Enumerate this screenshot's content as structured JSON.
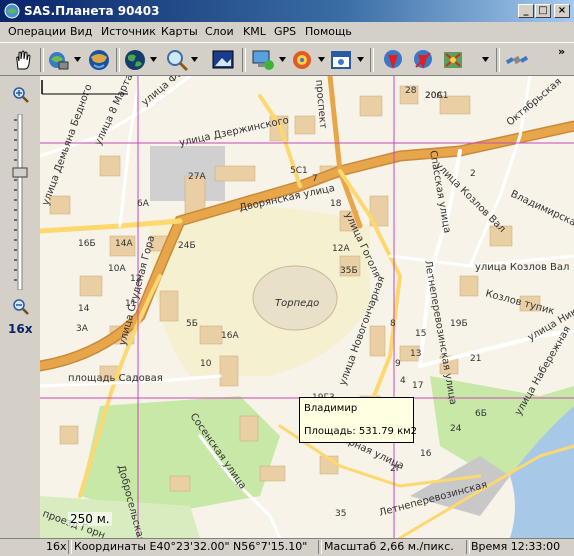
{
  "window": {
    "title": "SAS.Планета 90403"
  },
  "menu": [
    "Операции",
    "Вид",
    "Источник",
    "Карты",
    "Слои",
    "KML",
    "GPS",
    "Помощь"
  ],
  "zoom": {
    "level_label": "16x"
  },
  "map": {
    "street_labels": [
      "улица Дзержинского",
      "Дворянская улица",
      "проспект",
      "улица 8 Марта",
      "улица Демьяна Бедного",
      "улица Федосеева",
      "улица Студеная Гора",
      "улица Гоголя",
      "Летнеперевозинская улица",
      "улица Новогончарная",
      "Гончарная улица",
      "Сосенская улица",
      "Рыбацкий улица",
      "Спасская улица",
      "улица Козлов Вал",
      "улица Козлов Вал",
      "Козлов тупик",
      "улица Николо",
      "улица Набережная",
      "Октябрьская",
      "Владимирская",
      "площадь Садовая",
      "проезд Горн",
      "Торпедо",
      "Завальная улица",
      "Добросельская улица",
      "Летнеперевозинская"
    ],
    "house_numbers": [
      "28",
      "20А",
      "27А",
      "5С1",
      "7",
      "18",
      "6А",
      "16Б",
      "14А",
      "12А",
      "10А",
      "12",
      "35Б",
      "24Б",
      "11",
      "14",
      "5Б",
      "16А",
      "10",
      "9",
      "8",
      "17",
      "4",
      "19Г3",
      "13",
      "15",
      "19Б",
      "21",
      "20С1",
      "2",
      "6Б",
      "24",
      "2Г",
      "16",
      "3А",
      "35"
    ]
  },
  "tooltip": {
    "name": "Владимир",
    "area": "Площадь: 531.79 км2"
  },
  "scale": {
    "label": "250 м."
  },
  "status": {
    "zoom": "16x",
    "coords": "Координаты E40°23'32.00\" N56°7'15.10\"",
    "scale": "Масштаб 2,66 м./пикс.",
    "time": "Время 12:33:00"
  },
  "toolbar_icons": [
    "hand-icon",
    "layers-icon",
    "globe-icon",
    "earth-icon",
    "search-icon",
    "image-icon",
    "computer-network-icon",
    "gps-satellite-icon",
    "calendar-icon",
    "markers-icon",
    "mark-edit-icon",
    "mark-delete-icon",
    "overflow-chevron-icon",
    "satellite-icon"
  ],
  "colors": {
    "title_bg": "#0a246a",
    "road_major": "#e8a64b",
    "road_yellow": "#fcd86e",
    "park": "#c8e8a8",
    "building": "#e9cfa3",
    "water": "#a8c8e8",
    "grid": "#c84ab8"
  }
}
